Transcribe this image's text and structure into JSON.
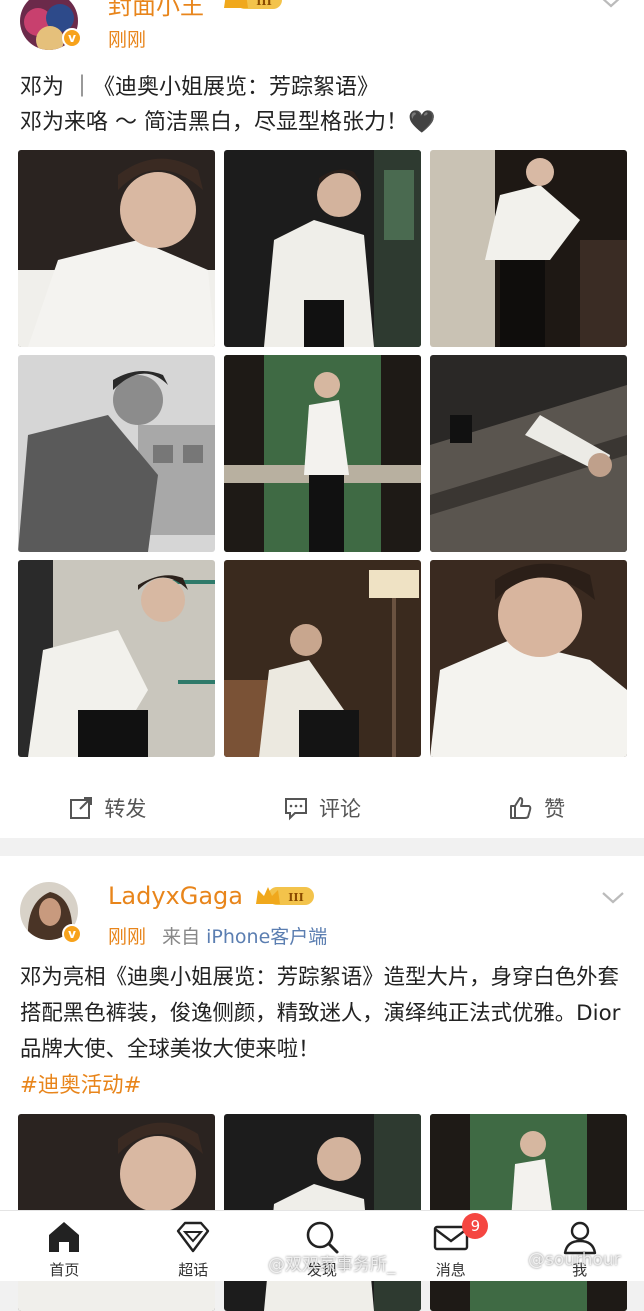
{
  "post1": {
    "author": "封面小王",
    "verified": "v",
    "level": "III",
    "time": "刚刚",
    "text_line1": "邓为 ｜《迪奥小姐展览：芳踪絮语》",
    "text_line2": "邓为来咯 ～ 简洁黑白，尽显型格张力！🖤"
  },
  "post2": {
    "author": "LadyxGaga",
    "verified": "v",
    "level": "III",
    "time": "刚刚",
    "from": "来自",
    "client": "iPhone客户端",
    "text": "邓为亮相《迪奥小姐展览：芳踪絮语》造型大片，身穿白色外套搭配黑色裤装，俊逸侧颜，精致迷人，演绎纯正法式优雅。Dior品牌大使、全球美妆大使来啦！",
    "topic": "#迪奥活动#"
  },
  "actions": {
    "repost": "转发",
    "comment": "评论",
    "like": "赞"
  },
  "tabs": [
    {
      "label": "首页",
      "icon": "home-icon"
    },
    {
      "label": "超话",
      "icon": "diamond-icon"
    },
    {
      "label": "发现",
      "icon": "search-icon"
    },
    {
      "label": "消息",
      "icon": "mail-icon",
      "badge": "9"
    },
    {
      "label": "我",
      "icon": "user-icon"
    }
  ],
  "watermarks": {
    "left": "@双双家事务所_",
    "right": "@sourhour"
  },
  "colors": {
    "accent": "#e8851b",
    "link": "#5b7eb1",
    "badge": "#f54641"
  }
}
